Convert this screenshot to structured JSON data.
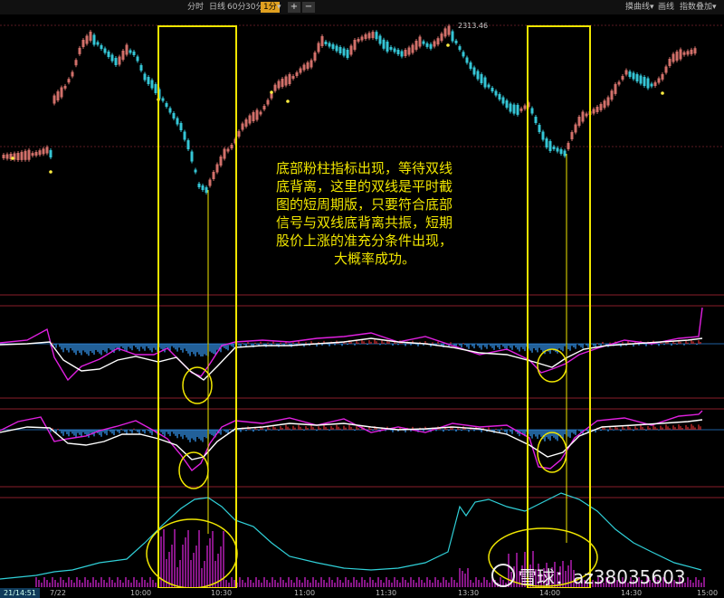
{
  "toolbar": {
    "periods": [
      {
        "label": "分时",
        "active": false
      },
      {
        "label": "日线",
        "active": false
      },
      {
        "label": "60分",
        "active": false
      },
      {
        "label": "30分",
        "active": false
      },
      {
        "label": "1分",
        "active": true
      }
    ],
    "dropdown_icon": "chevron-down-icon",
    "zoom_in": "+",
    "zoom_out": "−",
    "right_buttons": [
      "摸曲线",
      "画线",
      "指数叠加"
    ]
  },
  "price_label": "2313.46",
  "annotation_lines": [
    "底部粉柱指标出现，等待双线",
    "底背离，这里的双线是平时截",
    "图的短周期版，只要符合底部",
    "信号与双线底背离共振，短期",
    "股价上涨的准充分条件出现，",
    "大概率成功。"
  ],
  "time_axis": {
    "current": "21/14:51",
    "labels": [
      "7/22",
      "10:00",
      "10:30",
      "11:00",
      "11:30",
      "13:30",
      "14:00",
      "14:30",
      "15:00"
    ]
  },
  "watermark": "雪球：az38035603",
  "colors": {
    "up_candle": "#d2706a",
    "down_candle": "#35c6d6",
    "highlight_box": "#f0e600",
    "magenta_line": "#e020e0",
    "white_line": "#ffffff",
    "blue_bars": "#3aa0ff",
    "volume_line": "#30d0d8",
    "volume_bars": "#c020c0",
    "divider": "#8a1e2a"
  }
}
